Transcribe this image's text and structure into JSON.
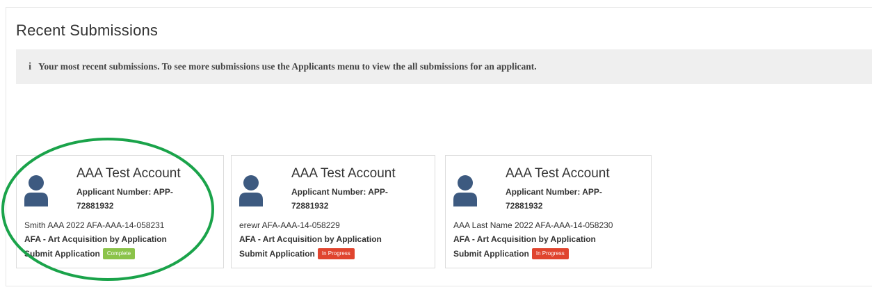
{
  "page": {
    "title": "Recent Submissions",
    "info_icon": "i",
    "info_text": "Your most recent submissions. To see more submissions use the Applicants menu to view the all submissions for an applicant."
  },
  "cards": [
    {
      "name": "AAA Test Account",
      "applicant_number": "Applicant Number: APP-72881932",
      "reference": "Smith AAA 2022 AFA-AAA-14-058231",
      "program": "AFA - Art Acquisition by Application",
      "action": "Submit Application",
      "status": "Complete",
      "status_color": "#8bc34a"
    },
    {
      "name": "AAA Test Account",
      "applicant_number": "Applicant Number: APP-72881932",
      "reference": "erewr AFA-AAA-14-058229",
      "program": "AFA - Art Acquisition by Application",
      "action": "Submit Application",
      "status": "In Progress",
      "status_color": "#e0442e"
    },
    {
      "name": "AAA Test Account",
      "applicant_number": "Applicant Number: APP-72881932",
      "reference": "AAA Last Name 2022 AFA-AAA-14-058230",
      "program": "AFA - Art Acquisition by Application",
      "action": "Submit Application",
      "status": "In Progress",
      "status_color": "#e0442e"
    }
  ],
  "icons": {
    "info": "info-icon",
    "avatar": "user-avatar-icon"
  },
  "annotation": {
    "highlight_color": "#1aa34a"
  }
}
